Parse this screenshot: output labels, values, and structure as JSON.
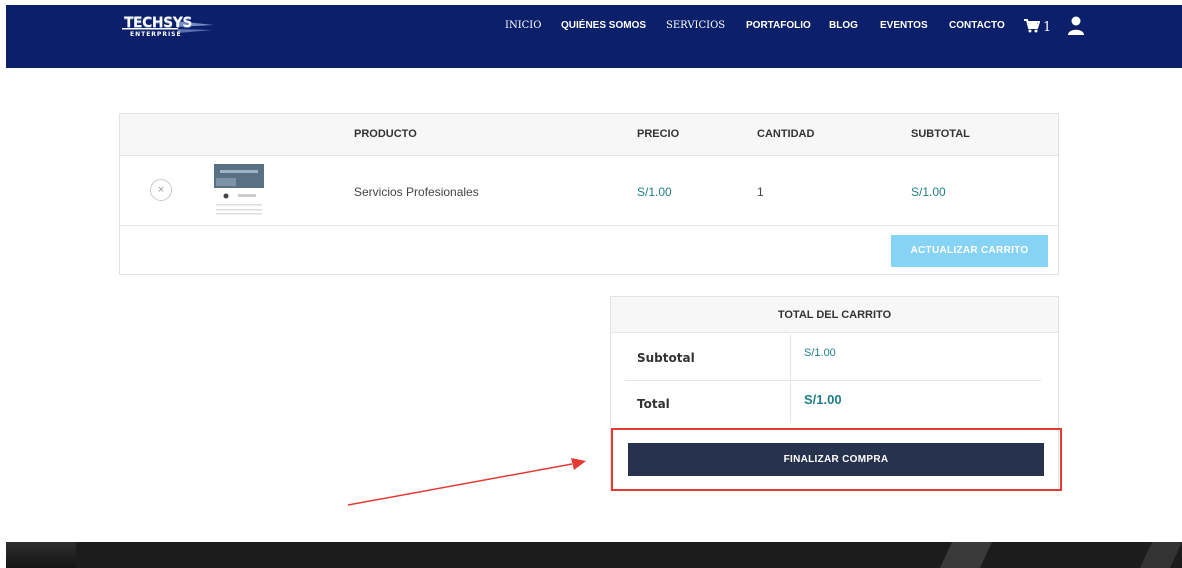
{
  "brand": {
    "logo_title": "TECHSYS",
    "logo_subtitle": "ENTERPRISE",
    "header_color": "#0b1f6b"
  },
  "nav": {
    "items": [
      {
        "label": "INICIO"
      },
      {
        "label": "QUIÉNES SOMOS"
      },
      {
        "label": "SERVICIOS"
      },
      {
        "label": "PORTAFOLIO"
      },
      {
        "label": "BLOG"
      },
      {
        "label": "EVENTOS"
      },
      {
        "label": "CONTACTO"
      }
    ],
    "cart_count": "1",
    "cart_icon": "cart-icon",
    "user_icon": "user-icon"
  },
  "cart_table": {
    "headers": {
      "product": "PRODUCTO",
      "price": "PRECIO",
      "quantity": "CANTIDAD",
      "subtotal": "SUBTOTAL"
    },
    "items": [
      {
        "remove_symbol": "×",
        "name": "Servicios Profesionales",
        "price": "S/1.00",
        "quantity": "1",
        "subtotal": "S/1.00"
      }
    ],
    "update_button": "ACTUALIZAR CARRITO"
  },
  "totals": {
    "title": "TOTAL DEL CARRITO",
    "subtotal_label": "Subtotal",
    "subtotal_value": "S/1.00",
    "total_label": "Total",
    "total_value": "S/1.00",
    "checkout_button": "FINALIZAR COMPRA"
  },
  "colors": {
    "accent_price": "#1f7e88",
    "update_button": "#86d3f5",
    "checkout_button": "#27334e",
    "highlight": "#e53935"
  }
}
